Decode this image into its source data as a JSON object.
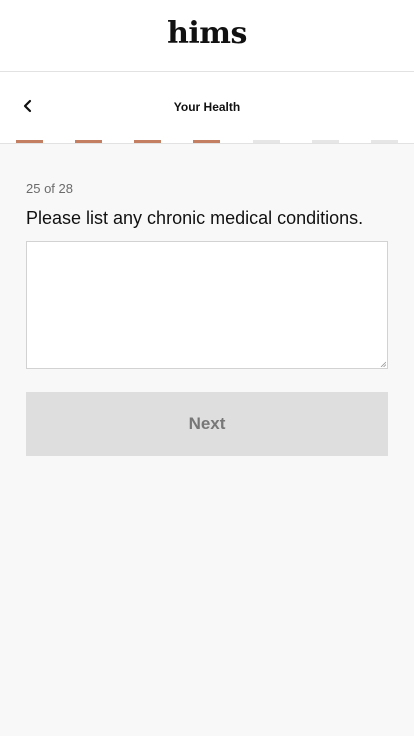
{
  "header": {
    "logo_text": "hims"
  },
  "subheader": {
    "back_icon": "chevron-left-icon",
    "title": "Your Health"
  },
  "progress": {
    "segments_total": 7,
    "segments_completed": 4,
    "completed_color": "#c47f63",
    "pending_color": "#e6e6e6"
  },
  "question": {
    "counter": "25 of 28",
    "text": "Please list any chronic medical conditions.",
    "answer_value": "",
    "answer_placeholder": ""
  },
  "actions": {
    "next_label": "Next"
  }
}
